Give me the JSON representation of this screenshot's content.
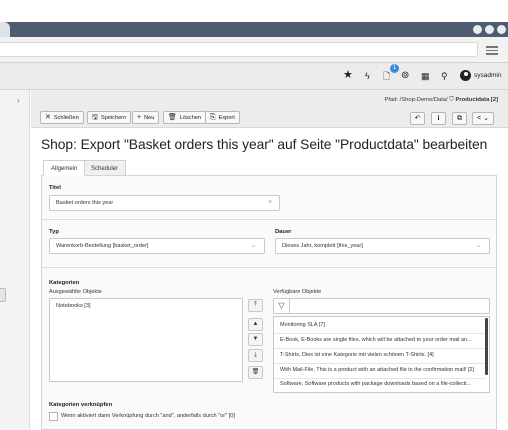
{
  "browser": {
    "notification_count": "1"
  },
  "toolbar": {
    "username": "sysadmin"
  },
  "docheader": {
    "path_label": "Pfad: /Shop-Demo/Data/",
    "path_page": "Productdata [2]",
    "buttons": {
      "close": "Schließen",
      "save": "Speichern",
      "new": "Neu",
      "delete": "Löschen",
      "export": "Export"
    }
  },
  "page": {
    "title": "Shop: Export \"Basket orders this year\" auf Seite \"Productdata\" bearbeiten"
  },
  "tabs": [
    {
      "label": "Allgemein"
    },
    {
      "label": "Scheduler"
    }
  ],
  "form": {
    "titel": {
      "label": "Titel",
      "value": "Basket orders this year"
    },
    "typ": {
      "label": "Typ",
      "value": "Warenkorb-Bestellung [basket_order]"
    },
    "dauer": {
      "label": "Dauer",
      "value": "Dieses Jahr, komplett [this_year]"
    },
    "kategorien": {
      "label": "Kategorien",
      "selected_label": "Ausgewählte Objekte",
      "available_label": "Verfügbare Objekte",
      "selected": [
        "Notebooks [3]"
      ],
      "available": [
        "Monitoring SLA [7]",
        "E-Book, E-Books are single files, which will be attached to your order mail an...",
        "T-Shirts, Dies ist eine Kategorie mit vielen schönen T-Shirts. [4]",
        "With Mail-File, This is a product with an attached file in the confirmation mail! [2]",
        "Software, Software products with package downloads based on a file-collecti..."
      ]
    },
    "verknuepfen": {
      "label": "Kategorien verknüpfen",
      "checkbox_text": "Wenn aktiviert dann Verknüpfung durch \"and\", anderfalls durch \"or\" [0]"
    }
  }
}
